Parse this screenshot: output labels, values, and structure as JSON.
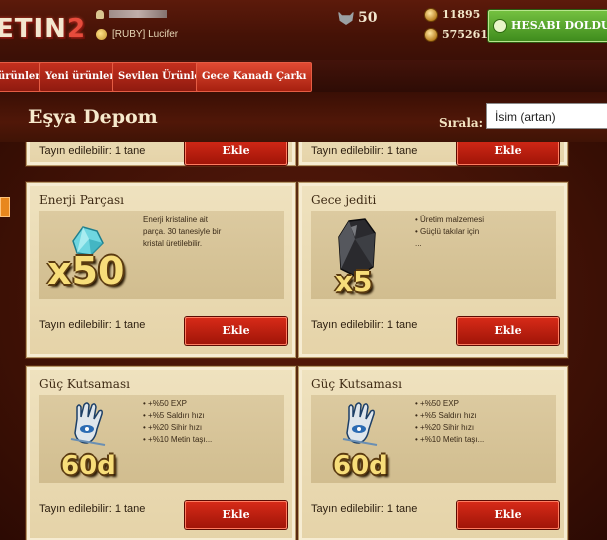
{
  "header": {
    "logo_text_a": "ETIN",
    "logo_text_b": "2",
    "guild": "[RUBY] Lucifer",
    "wolf_count": "50",
    "coins_1": "11895",
    "coins_2": "575261",
    "topup_label": "HESABI DOLDUR"
  },
  "nav": {
    "tabs": [
      {
        "label": "ürünler"
      },
      {
        "label": "Yeni ürünler"
      },
      {
        "label": "Sevilen Ürünler"
      },
      {
        "label": "Gece Kanadı Çarkı"
      }
    ]
  },
  "page": {
    "title": "Eşya Depom",
    "sort_label": "Sırala:",
    "sort_value": "İsim (artan)"
  },
  "top_partial": {
    "tradable_left": "Tayın edilebilir: 1 tane",
    "tradable_right": "Tayın edilebilir: 1 tane",
    "button": "Ekle"
  },
  "items": [
    {
      "title": "Enerji Parçası",
      "desc": [
        "Enerji kristaline ait",
        "parça. 30 tanesiyle bir",
        "kristal üretilebilir."
      ],
      "qty": "x50",
      "tradable": "Tayın edilebilir: 1 tane",
      "button": "Ekle",
      "icon": "energy-crystal-icon"
    },
    {
      "title": "Gece jediti",
      "desc": [
        "• Üretim malzemesi",
        "• Güçlü takılar için",
        "",
        "..."
      ],
      "qty": "x5",
      "tradable": "Tayın edilebilir: 1 tane",
      "button": "Ekle",
      "icon": "night-jade-icon"
    },
    {
      "title": "Güç Kutsaması",
      "desc": [
        "• +%50 EXP",
        "• +%5 Saldırı hızı",
        "• +%20 Sihir hızı",
        "• +%10 Metin taşı..."
      ],
      "qty": "60d",
      "tradable": "Tayın edilebilir: 1 tane",
      "button": "Ekle",
      "icon": "hamsa-blessing-icon"
    },
    {
      "title": "Güç Kutsaması",
      "desc": [
        "• +%50 EXP",
        "• +%5 Saldırı hızı",
        "• +%20 Sihir hızı",
        "• +%10 Metin taşı..."
      ],
      "qty": "60d",
      "tradable": "Tayın edilebilir: 1 tane",
      "button": "Ekle",
      "icon": "hamsa-blessing-icon"
    }
  ]
}
